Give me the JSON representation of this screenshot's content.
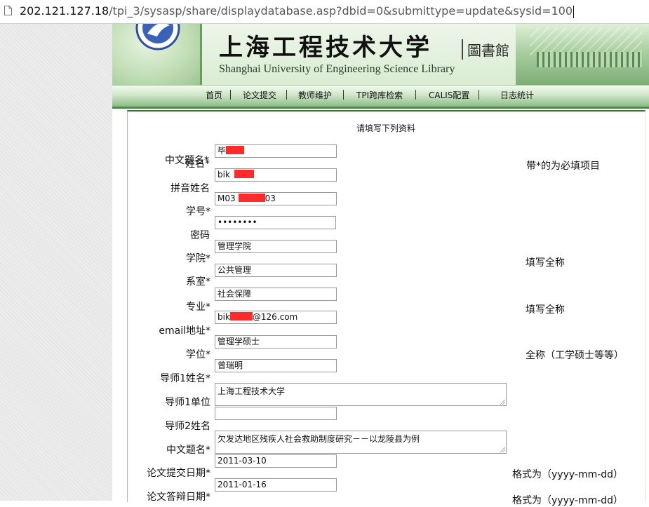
{
  "address_bar": {
    "host": "202.121.127.18",
    "path": "/tpi_3/sysasp/share/displaydatabase.asp?dbid=0&submittype=update&sysid=100"
  },
  "banner": {
    "cn_title": "上海工程技术大学",
    "library_tag": "圖書館",
    "en_title": "Shanghai University of Engineering Science Library"
  },
  "nav": {
    "items": [
      "首页",
      "论文提交",
      "教师维护",
      "TPI跨库检索",
      "CALIS配置",
      "日志统计"
    ]
  },
  "form": {
    "title": "请填写下列资料",
    "fields": [
      {
        "label": "中文题名*",
        "value": "毕"
      },
      {
        "label": "姓名*",
        "value": "毕"
      },
      {
        "label": "拼音姓名",
        "value": "bik"
      },
      {
        "label": "学号*",
        "value_prefix": "M03",
        "value_suffix": "03"
      },
      {
        "label": "密码",
        "value": "••••••••"
      },
      {
        "label": "学院*",
        "value": "管理学院"
      },
      {
        "label": "系室*",
        "value": "公共管理"
      },
      {
        "label": "专业*",
        "value": "社会保障"
      },
      {
        "label": "email地址*",
        "value_prefix": "bik",
        "value_suffix": "@126.com"
      },
      {
        "label": "学位*",
        "value": "管理学硕士"
      },
      {
        "label": "导师1姓名*",
        "value": "曾瑞明"
      },
      {
        "label": "导师1单位",
        "value": "上海工程技术大学"
      },
      {
        "label": "导师2姓名",
        "value": ""
      },
      {
        "label": "中文题名*",
        "value": "欠发达地区残疾人社会救助制度研究－－以龙陵县为例"
      },
      {
        "label": "论文提交日期*",
        "value": "2011-03-10"
      },
      {
        "label": "论文答辩日期*",
        "value": "2011-01-16"
      }
    ],
    "notes": {
      "required": "带*的为必填项目",
      "fullname1": "填写全称",
      "fullname2": "填写全称",
      "degree": "全称（工学硕士等等）",
      "date1": "格式为（yyyy-mm-dd）",
      "date2": "格式为（yyyy-mm-dd）"
    }
  },
  "colors": {
    "nav_border": "#4d8a47",
    "redaction": "#ff2a2a"
  }
}
